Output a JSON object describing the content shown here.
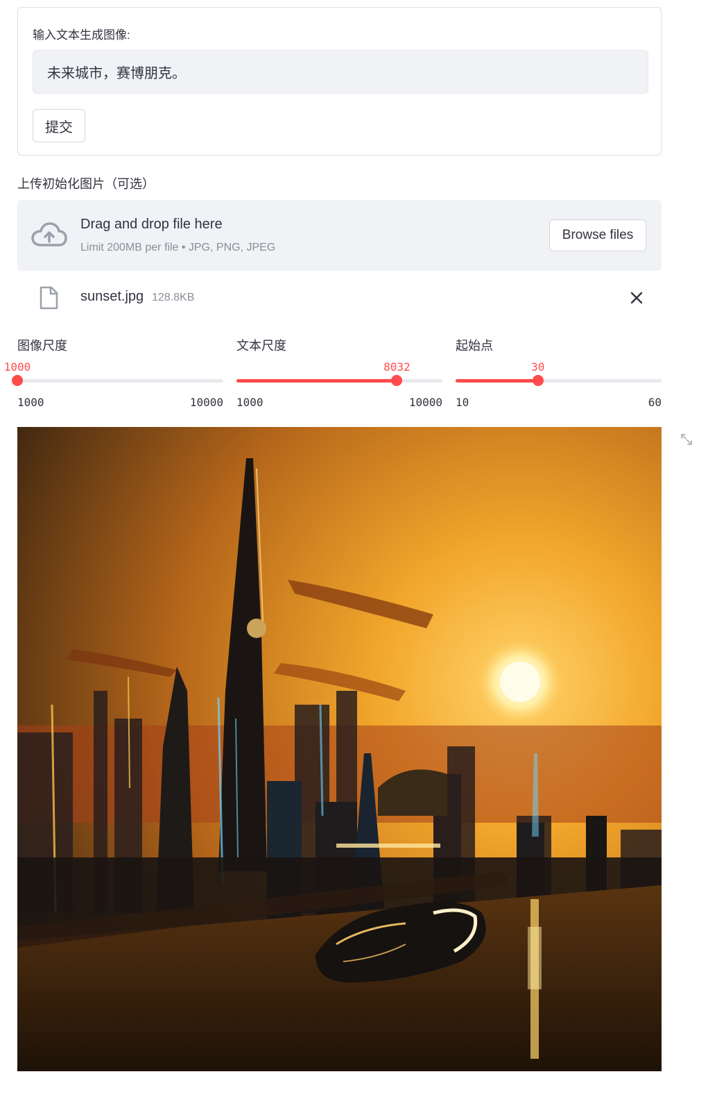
{
  "form": {
    "label": "输入文本生成图像:",
    "input_value": "未来城市，赛博朋克。",
    "submit_label": "提交"
  },
  "uploader": {
    "label": "上传初始化图片（可选）",
    "drop_title": "Drag and drop file here",
    "drop_hint": "Limit 200MB per file • JPG, PNG, JPEG",
    "browse_label": "Browse files",
    "icon": "cloud-upload-icon"
  },
  "uploaded_file": {
    "name": "sunset.jpg",
    "size": "128.8KB",
    "icon": "file-icon",
    "remove_icon": "close-icon"
  },
  "sliders": [
    {
      "label": "图像尺度",
      "value": "1000",
      "min": "1000",
      "max": "10000"
    },
    {
      "label": "文本尺度",
      "value": "8032",
      "min": "1000",
      "max": "10000"
    },
    {
      "label": "起始点",
      "value": "30",
      "min": "10",
      "max": "60"
    }
  ],
  "colors": {
    "accent": "#ff4b4b",
    "text": "#31333f",
    "input_bg": "#f0f2f6",
    "muted": "#8a8d96"
  },
  "image": {
    "icon": "expand-icon"
  }
}
